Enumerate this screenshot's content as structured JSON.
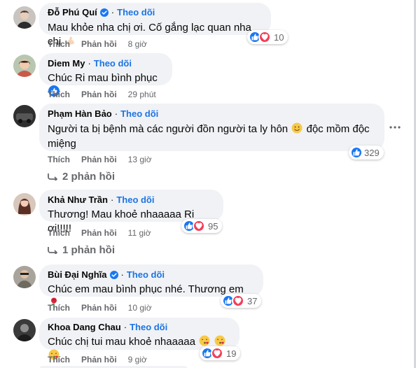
{
  "colors": {
    "accent": "#1b74e4",
    "bubble": "#f0f2f5",
    "muted": "#65676b",
    "like": "#1877f2",
    "love": "#f33e58"
  },
  "comments": [
    {
      "author": "Đỗ Phú Quí",
      "verified": true,
      "follow_label": "Theo dõi",
      "text": "Mau khỏe nha chị ơi. Cố gắng lạc quan nha chị",
      "emojis": [
        "flexed-biceps"
      ],
      "reactions": {
        "icons": [
          "like-icon",
          "love-icon"
        ],
        "count": "10"
      },
      "actions": {
        "like": "Thích",
        "reply": "Phản hồi",
        "time": "8 giờ"
      }
    },
    {
      "author": "Diem My",
      "verified": false,
      "follow_label": "Theo dõi",
      "text": "Chúc Ri mau bình phục",
      "emojis": [
        "thumbs-up"
      ],
      "actions": {
        "like": "Thích",
        "reply": "Phản hồi",
        "time": "29 phút"
      }
    },
    {
      "author": "Phạm Hàn Bảo",
      "verified": false,
      "follow_label": "Theo dõi",
      "text_line1": "Người ta bị bệnh mà các người đồn người ta ly hôn",
      "text_line1_after": "độc mồm độc",
      "text_line2": "miệng",
      "emojis": [
        "smiling-face"
      ],
      "reactions": {
        "icons": [
          "like-icon"
        ],
        "count": "329"
      },
      "actions": {
        "like": "Thích",
        "reply": "Phản hồi",
        "time": "13 giờ"
      },
      "replies_label": "2 phản hồi",
      "more_icon": "more-options-icon"
    },
    {
      "author": "Khả Như Trần",
      "verified": false,
      "follow_label": "Theo dõi",
      "text": "Thương! Mau khoẻ nhaaaaa Ri ơi!!!!!",
      "reactions": {
        "icons": [
          "like-icon",
          "love-icon"
        ],
        "count": "95"
      },
      "actions": {
        "like": "Thích",
        "reply": "Phản hồi",
        "time": "11 giờ"
      },
      "replies_label": "1 phản hồi"
    },
    {
      "author": "Bùi Đại Nghĩa",
      "verified": true,
      "follow_label": "Theo dõi",
      "text": "Chúc em mau bình phục nhé. Thương em",
      "emojis": [
        "rose"
      ],
      "reactions": {
        "icons": [
          "like-icon",
          "love-icon"
        ],
        "count": "37"
      },
      "actions": {
        "like": "Thích",
        "reply": "Phản hồi",
        "time": "10 giờ"
      }
    },
    {
      "author": "Khoa Dang Chau",
      "verified": false,
      "follow_label": "Theo dõi",
      "text": "Chúc chị tui mau khoẻ nhaaaaa",
      "emojis": [
        "kissing-face",
        "kissing-face",
        "kissing-face"
      ],
      "reactions": {
        "icons": [
          "like-icon",
          "love-icon"
        ],
        "count": "19"
      },
      "actions": {
        "like": "Thích",
        "reply": "Phản hồi",
        "time": "9 giờ"
      }
    }
  ]
}
